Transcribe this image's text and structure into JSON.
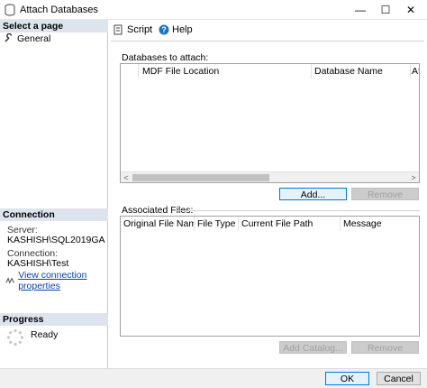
{
  "window": {
    "title": "Attach Databases",
    "controls": {
      "minimize": "—",
      "maximize": "☐",
      "close": "✕"
    }
  },
  "left": {
    "select_page_header": "Select a page",
    "pages": [
      {
        "label": "General"
      }
    ],
    "connection_header": "Connection",
    "server_label": "Server:",
    "server_value": "KASHISH\\SQL2019GA",
    "connection_label": "Connection:",
    "connection_value": "KASHISH\\Test",
    "view_connection_properties": "View connection properties",
    "progress_header": "Progress",
    "progress_status": "Ready"
  },
  "toolbar": {
    "script": "Script",
    "help": "Help"
  },
  "databases": {
    "label": "Databases to attach:",
    "columns": [
      "MDF File Location",
      "Database Name",
      "Af"
    ],
    "add_button": "Add...",
    "remove_button": "Remove"
  },
  "associated": {
    "label": "Associated Files:",
    "columns": [
      "Original File Name",
      "File Type",
      "Current File Path",
      "Message"
    ],
    "add_catalog_button": "Add Catalog...",
    "remove_button": "Remove"
  },
  "footer": {
    "ok": "OK",
    "cancel": "Cancel"
  },
  "colors": {
    "accent": "#0078d7",
    "section_header_bg": "#dde4ee",
    "link": "#0645ad"
  }
}
